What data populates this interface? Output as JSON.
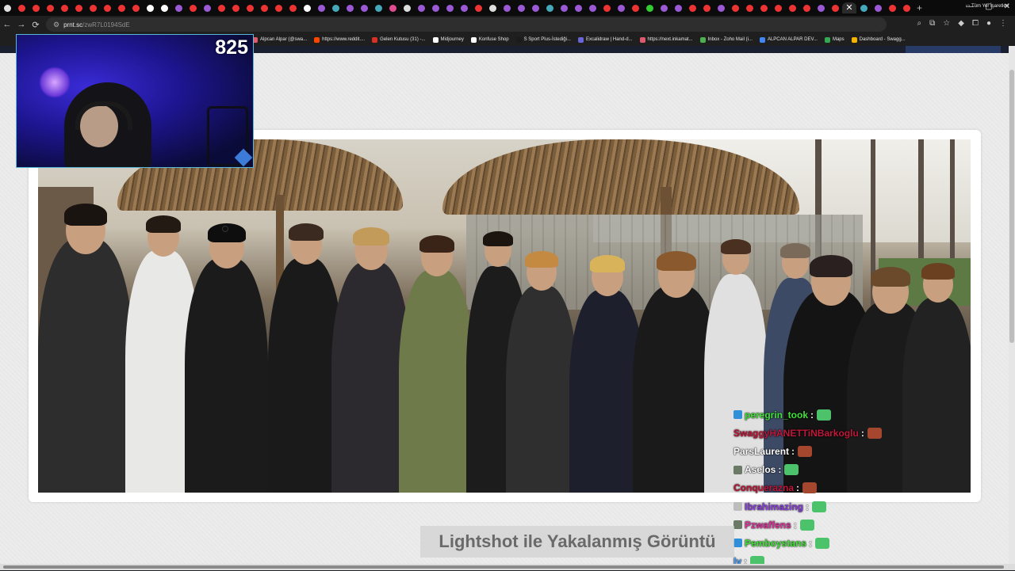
{
  "browser": {
    "address_bar": {
      "host": "prnt.sc",
      "path": "/zwR7L0194SdE"
    },
    "tab_count": 64,
    "new_tab": "+",
    "bookmarks": [
      {
        "label": "Alpcan Alpar (@swa...",
        "color": "#e05a6e"
      },
      {
        "label": "https://www.reddit....",
        "color": "#ff4500"
      },
      {
        "label": "Gelen Kutusu (31) -...",
        "color": "#d93025"
      },
      {
        "label": "Midjourney",
        "color": "#ffffff"
      },
      {
        "label": "Konfuse Shop",
        "color": "#ffffff"
      },
      {
        "label": "S Sport Plus-İstediği...",
        "color": "#1b1b1b"
      },
      {
        "label": "Excalidraw | Hand-d...",
        "color": "#6965db"
      },
      {
        "label": "https://next.inkamat...",
        "color": "#e05a6e"
      },
      {
        "label": "Inbox - Zoho Mail (i...",
        "color": "#4caf50"
      },
      {
        "label": "ALPCAN ALPAR DEV...",
        "color": "#4285f4"
      },
      {
        "label": "Maps",
        "color": "#34a853"
      },
      {
        "label": "Dashboard - Swagg...",
        "color": "#f4b400"
      }
    ],
    "bookmarks_all": "Tüm Yer İşaretleri"
  },
  "webcam": {
    "viewer_count": "825"
  },
  "chat": [
    {
      "user": "peregrin_took",
      "color": "#44e33b",
      "badge": "#2f8fd8",
      "emote": "#4cc36a"
    },
    {
      "user": "SwaggyHANETTiNBarkoglu",
      "color": "#c0173a",
      "badge": "",
      "emote": "#a5472e"
    },
    {
      "user": "ParsLaurent",
      "color": "#ffffff",
      "badge": "",
      "emote": "#a5472e"
    },
    {
      "user": "Aselos",
      "color": "#ffffff",
      "badge": "#6b7a66",
      "emote": "#4cc36a"
    },
    {
      "user": "Conquerazna",
      "color": "#c0173a",
      "badge": "",
      "emote": "#a5472e"
    },
    {
      "user": "Ibrahimazing",
      "color": "#8b3fdc",
      "badge": "#bdbdbd",
      "emote": "#4cc36a"
    },
    {
      "user": "Pzwaffens",
      "color": "#e0359e",
      "badge": "#6b7a66",
      "emote": "#4cc36a"
    },
    {
      "user": "Pemboystans",
      "color": "#44e33b",
      "badge": "#2f8fd8",
      "emote": "#4cc36a"
    },
    {
      "user": "ly",
      "color": "#4aa0ff",
      "badge": "",
      "emote": "#4cc36a"
    }
  ],
  "caption": "Lightshot ile Yakalanmış Görüntü"
}
